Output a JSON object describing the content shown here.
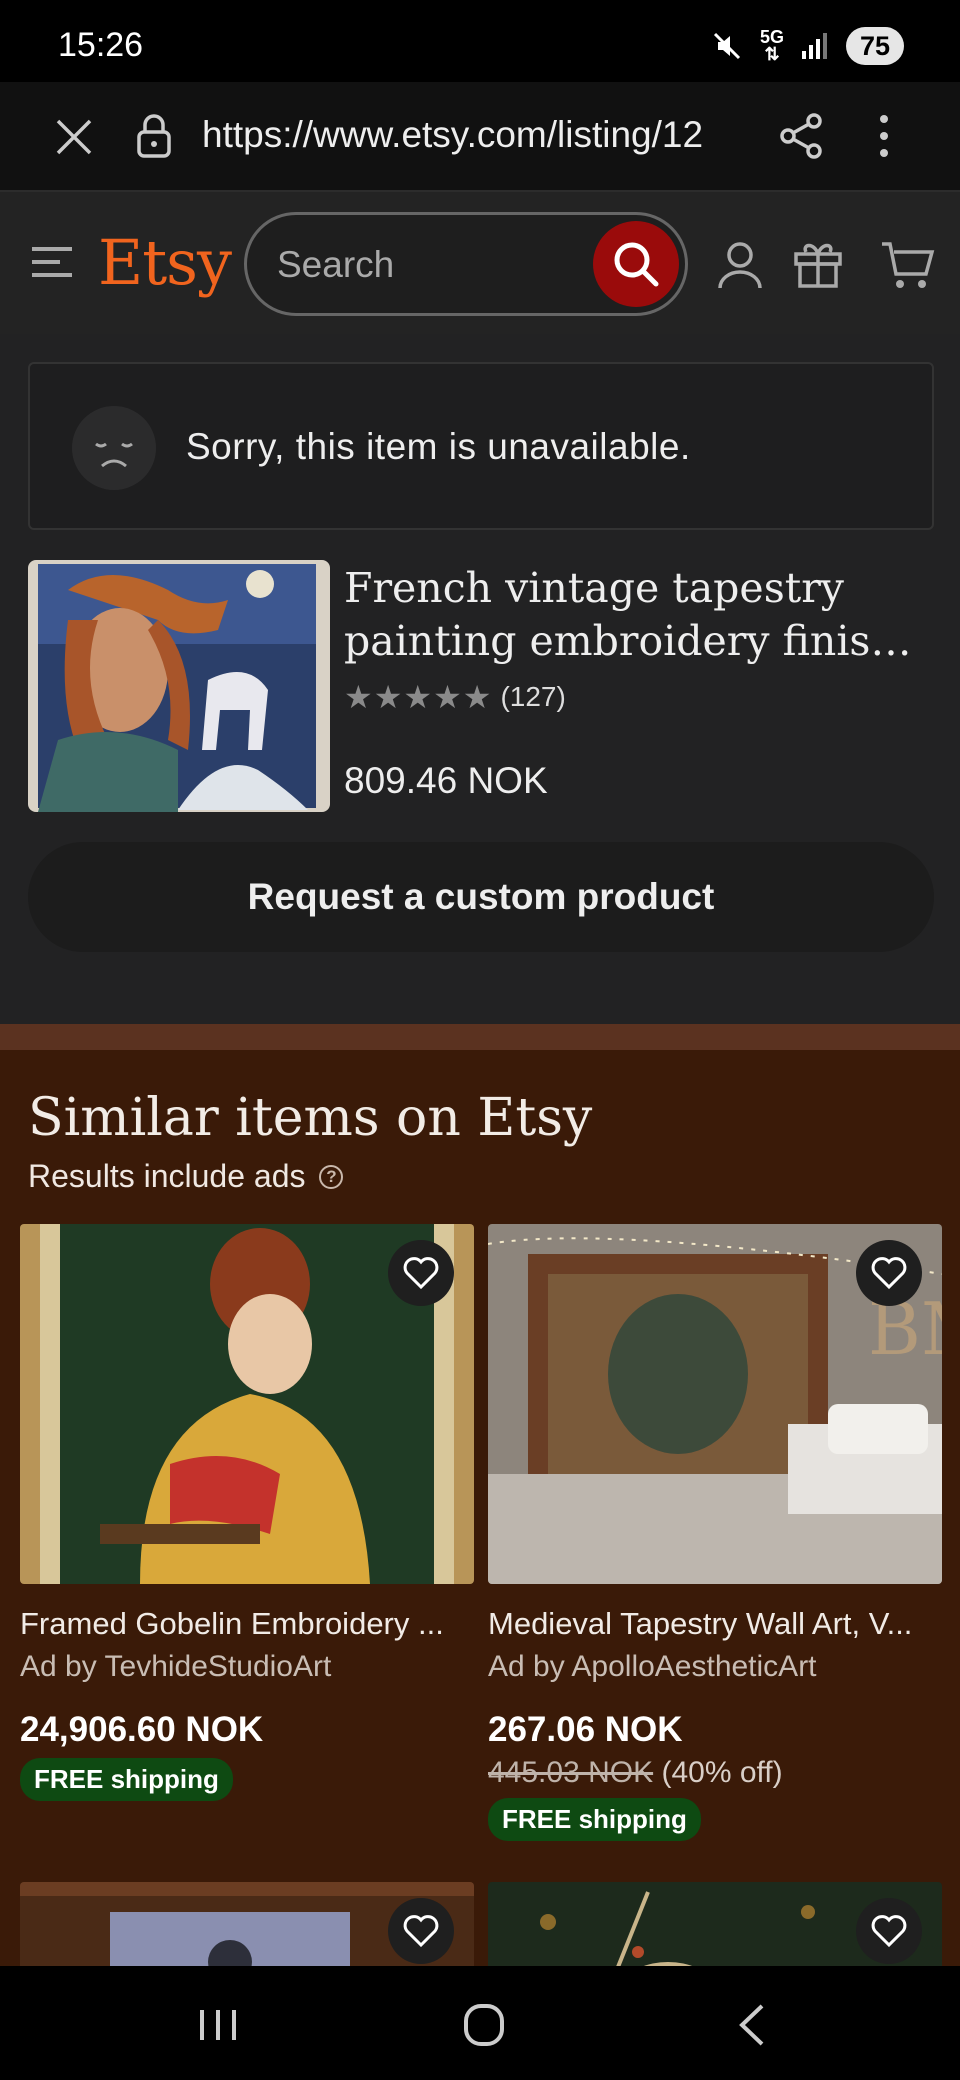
{
  "status_bar": {
    "time": "15:26",
    "network": "5G",
    "battery": "75"
  },
  "browser": {
    "url": "https://www.etsy.com/listing/12"
  },
  "header": {
    "logo": "Etsy",
    "search_placeholder": "Search"
  },
  "unavailable": {
    "message": "Sorry, this item is unavailable."
  },
  "product": {
    "title_line1": "French vintage tapestry",
    "title_line2": "painting embroidery finished...",
    "stars": "★★★★★",
    "rating_count": "(127)",
    "price": "809.46 NOK"
  },
  "custom_button": "Request a custom product",
  "similar": {
    "title": "Similar items on Etsy",
    "results_note": "Results include ads",
    "help_glyph": "?",
    "items": [
      {
        "title": "Framed Gobelin Embroidery ...",
        "seller": "Ad by TevhideStudioArt",
        "price": "24,906.60 NOK",
        "shipping": "FREE shipping"
      },
      {
        "title": "Medieval Tapestry Wall Art, V...",
        "seller": "Ad by ApolloAestheticArt",
        "price": "267.06 NOK",
        "original_price": "445.03 NOK",
        "discount": "(40% off)",
        "shipping": "FREE shipping"
      }
    ]
  },
  "colors": {
    "etsy_orange": "#f1641e",
    "search_button": "#9a0b0b",
    "similar_bg": "#3a1a08",
    "shipping_badge": "#0e4a12"
  }
}
